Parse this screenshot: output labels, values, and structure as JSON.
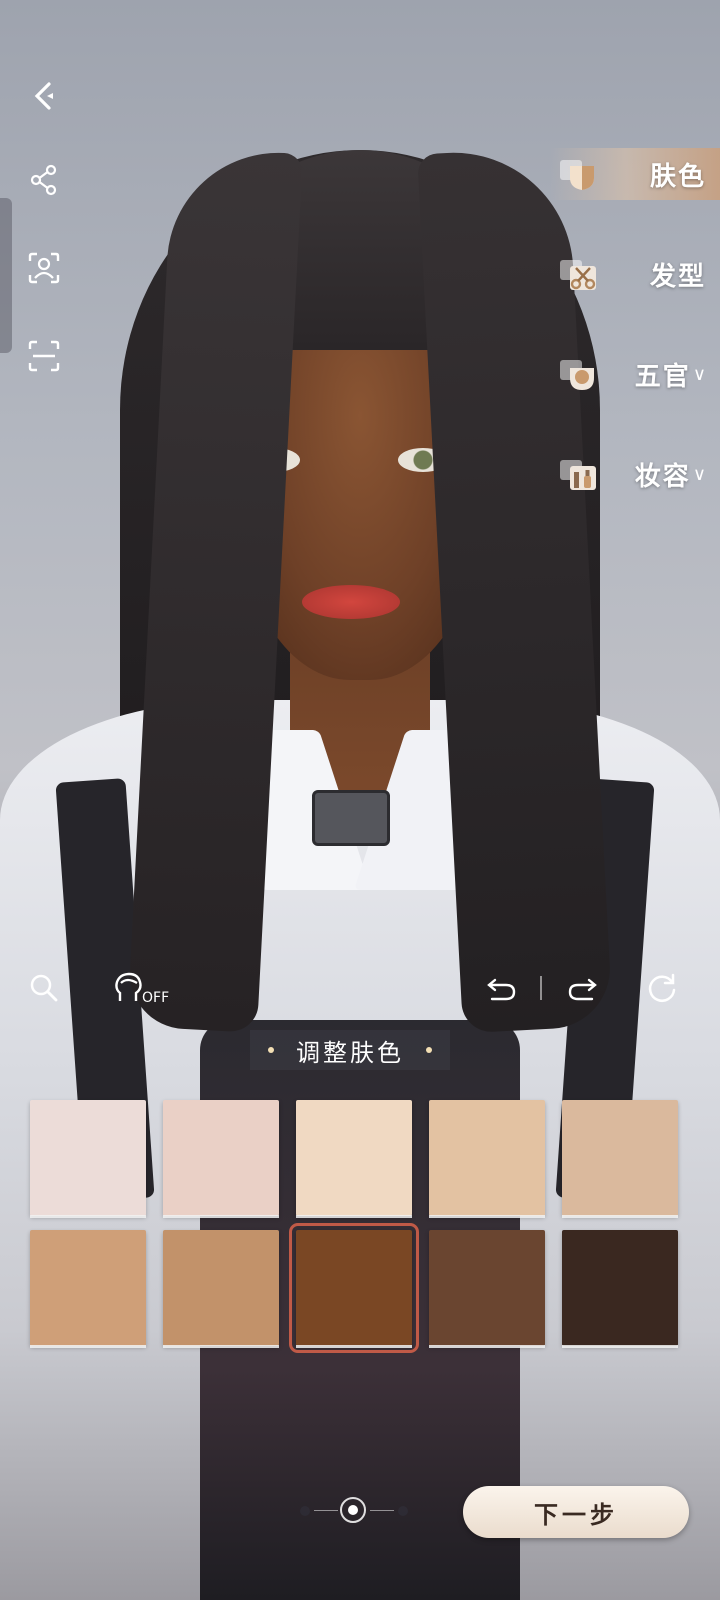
{
  "categories": [
    {
      "label": "肤色",
      "active": true,
      "has_dropdown": false,
      "icon": "skin-tone-icon"
    },
    {
      "label": "发型",
      "active": false,
      "has_dropdown": false,
      "icon": "scissors-icon"
    },
    {
      "label": "五官",
      "active": false,
      "has_dropdown": true,
      "icon": "face-features-icon"
    },
    {
      "label": "妆容",
      "active": false,
      "has_dropdown": true,
      "icon": "makeup-icon"
    }
  ],
  "toolbar": {
    "hair_toggle_state": "OFF"
  },
  "section": {
    "title": "调整肤色"
  },
  "swatches": [
    {
      "color": "#ecdcd8",
      "selected": false
    },
    {
      "color": "#ead0c6",
      "selected": false
    },
    {
      "color": "#f0d9c2",
      "selected": false
    },
    {
      "color": "#e3c2a2",
      "selected": false
    },
    {
      "color": "#dab99d",
      "selected": false
    },
    {
      "color": "#cf9f78",
      "selected": false
    },
    {
      "color": "#c2926a",
      "selected": false
    },
    {
      "color": "#7a4724",
      "selected": true
    },
    {
      "color": "#6a4530",
      "selected": false
    },
    {
      "color": "#3a2820",
      "selected": false
    }
  ],
  "pager": {
    "current_page": 2,
    "total_pages": 3
  },
  "next_button": {
    "label": "下一步"
  },
  "accent_color": "#c05a47"
}
